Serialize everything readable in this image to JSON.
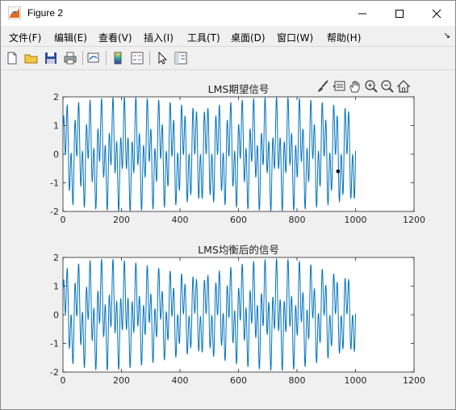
{
  "window": {
    "title": "Figure 2",
    "icon": "matlab-icon"
  },
  "menu": [
    {
      "label": "文件(F)",
      "key": "F"
    },
    {
      "label": "编辑(E)",
      "key": "E"
    },
    {
      "label": "查看(V)",
      "key": "V"
    },
    {
      "label": "插入(I)",
      "key": "I"
    },
    {
      "label": "工具(T)",
      "key": "T"
    },
    {
      "label": "桌面(D)",
      "key": "D"
    },
    {
      "label": "窗口(W)",
      "key": "W"
    },
    {
      "label": "帮助(H)",
      "key": "H"
    }
  ],
  "menu_overflow": "↘",
  "toolbar": [
    "new-figure-icon",
    "open-file-icon",
    "save-icon",
    "print-icon",
    "link-plot-icon",
    "insert-colorbar-icon",
    "insert-legend-icon",
    "edit-plot-icon",
    "property-inspector-icon"
  ],
  "axes_toolbar": [
    "brush-icon",
    "data-tips-icon",
    "pan-icon",
    "zoom-in-icon",
    "zoom-out-icon",
    "restore-view-icon"
  ],
  "colors": {
    "line": "#0072bd",
    "axes_bg": "#ffffff",
    "figure_bg": "#f0f0f0"
  },
  "chart_data": [
    {
      "type": "line",
      "title": "LMS期望信号",
      "xlim": [
        0,
        1200
      ],
      "ylim": [
        -2,
        2
      ],
      "xticks": [
        0,
        200,
        400,
        600,
        800,
        1000,
        1200
      ],
      "yticks": [
        -2,
        -1,
        0,
        1,
        2
      ],
      "series": [
        {
          "x_range": [
            1,
            1000
          ],
          "formula": "sin(2*pi*x/40)+sin(2*pi*x/13)",
          "note_points": 1000
        }
      ],
      "marker": {
        "x": 940,
        "y": -0.6
      }
    },
    {
      "type": "line",
      "title": "LMS均衡后的信号",
      "xlim": [
        0,
        1200
      ],
      "ylim": [
        -2,
        2
      ],
      "xticks": [
        0,
        200,
        400,
        600,
        800,
        1000,
        1200
      ],
      "yticks": [
        -2,
        -1,
        0,
        1,
        2
      ],
      "series": [
        {
          "x_range": [
            1,
            1000
          ],
          "formula": "sin(2*pi*x/40)+sin(2*pi*x/13)",
          "note_points": 1000
        }
      ]
    }
  ]
}
